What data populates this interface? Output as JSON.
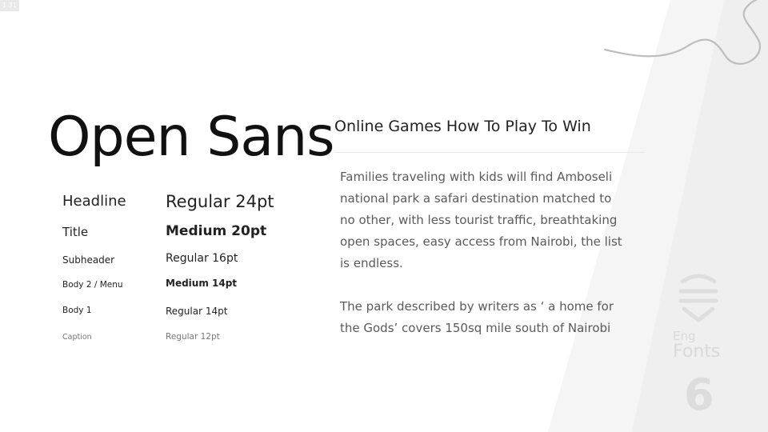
{
  "version_badge": "1.31",
  "font_name": "Open Sans",
  "specs": [
    {
      "label": "Headline",
      "value": "Regular 24pt"
    },
    {
      "label": "Title",
      "value": "Medium 20pt"
    },
    {
      "label": "Subheader",
      "value": "Regular 16pt"
    },
    {
      "label": "Body 2 / Menu",
      "value": "Medium 14pt"
    },
    {
      "label": "Body 1",
      "value": "Regular 14pt"
    },
    {
      "label": "Caption",
      "value": "Regular 12pt"
    }
  ],
  "sample": {
    "heading": "Online Games How To Play To Win",
    "paragraph1": "Families traveling with kids will find Amboseli national park a safari destination matched to no other, with less tourist traffic, breathtaking open spaces, easy access from Nairobi, the list is endless.",
    "paragraph2": "The park described by writers as ‘ a home for the Gods’ covers 150sq mile south of Nairobi"
  },
  "brand": {
    "small": "Eng",
    "large": "Fonts",
    "logo_icon": "stacked-chevron-shield-icon"
  },
  "slide_number": "6",
  "colors": {
    "background": "#ffffff",
    "stripe": "#f3f3f3",
    "muted_text": "#d9d9d9",
    "body_text": "#5a5a5a"
  }
}
